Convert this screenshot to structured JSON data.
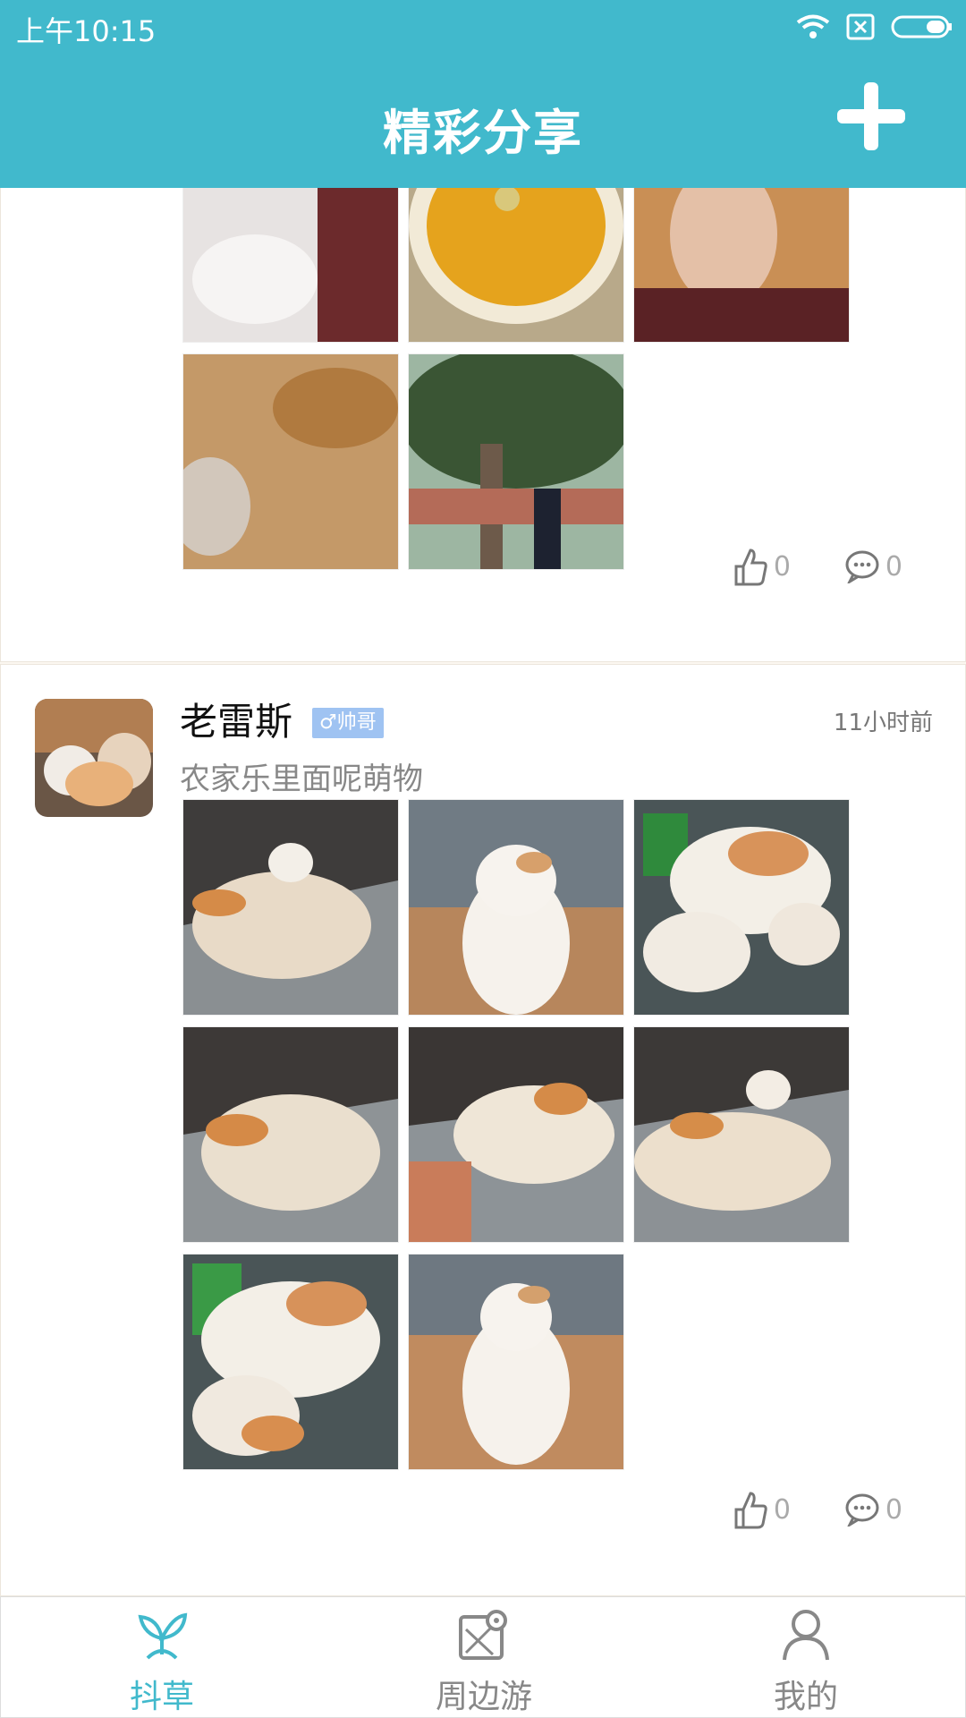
{
  "status": {
    "time": "上午10:15"
  },
  "header": {
    "title": "精彩分享"
  },
  "posts": [
    {
      "likes": "0",
      "comments": "0"
    },
    {
      "name": "老雷斯",
      "badge": "♂帅哥",
      "time": "11小时前",
      "text": "农家乐里面呢萌物",
      "likes": "0",
      "comments": "0"
    }
  ],
  "nav": [
    {
      "label": "抖草",
      "icon": "sprout-icon",
      "active": true
    },
    {
      "label": "周边游",
      "icon": "map-pin-icon",
      "active": false
    },
    {
      "label": "我的",
      "icon": "user-icon",
      "active": false
    }
  ],
  "colors": {
    "accent": "#41b9cc",
    "badge": "#9fc3f2"
  }
}
